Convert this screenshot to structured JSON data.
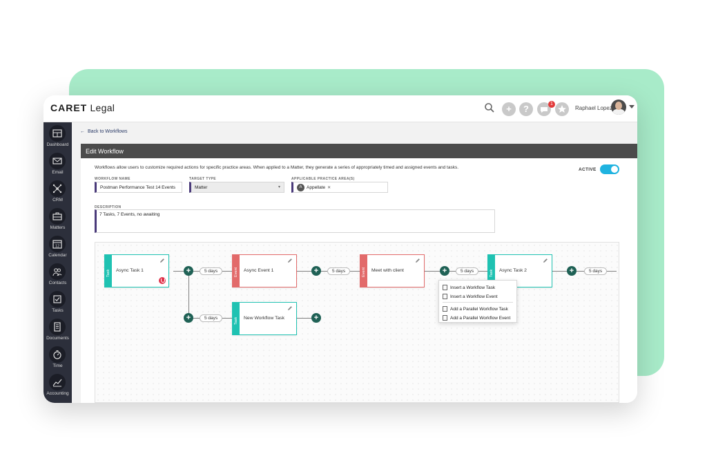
{
  "app": {
    "logo_prefix": "CARET",
    "logo_suffix": "Legal",
    "user_name": "Raphael Lopez",
    "notification_count": "1"
  },
  "toolbar": {
    "add_icon": "plus-icon",
    "help_label": "?",
    "icons": [
      "search-icon",
      "plus-icon",
      "help-icon",
      "chat-icon",
      "star-icon"
    ]
  },
  "sidebar": {
    "items": [
      {
        "label": "Dashboard",
        "icon": "dashboard-icon"
      },
      {
        "label": "Email",
        "icon": "envelope-icon"
      },
      {
        "label": "CRM",
        "icon": "network-icon"
      },
      {
        "label": "Matters",
        "icon": "briefcase-icon"
      },
      {
        "label": "Calendar",
        "icon": "calendar-icon"
      },
      {
        "label": "Contacts",
        "icon": "people-icon"
      },
      {
        "label": "Tasks",
        "icon": "checkbox-icon"
      },
      {
        "label": "Documents",
        "icon": "document-icon"
      },
      {
        "label": "Time",
        "icon": "timer-icon"
      },
      {
        "label": "Accounting",
        "icon": "chart-icon"
      }
    ]
  },
  "page": {
    "back_label": "Back to Workflows",
    "title": "Edit Workflow",
    "intro": "Workflows allow users to customize required actions for specific practice areas. When applied to a Matter, they generate a series of appropriately timed and assigned events and tasks.",
    "active_label": "ACTIVE",
    "active": true
  },
  "form": {
    "workflow_name_label": "WORKFLOW NAME",
    "workflow_name_value": "Postman Performance Test  14 Events",
    "target_type_label": "TARGET TYPE",
    "target_type_value": "Matter",
    "practice_area_label": "APPLICABLE PRACTICE AREA(S)",
    "practice_area_chip_initial": "A",
    "practice_area_chip": "Appellate",
    "description_label": "DESCRIPTION",
    "description_value": "7 Tasks, 7 Events, no awaiting"
  },
  "workflow": {
    "cards": [
      {
        "type": "Task",
        "title": "Async Task 1"
      },
      {
        "type": "Event",
        "title": "Async Event 1"
      },
      {
        "type": "Event",
        "title": "Meet with client"
      },
      {
        "type": "Task",
        "title": "Async Task 2"
      },
      {
        "type": "Task",
        "title": "New Workflow Task"
      }
    ],
    "delays": [
      "5 days",
      "5 days",
      "5 days",
      "5 days",
      "5 days"
    ],
    "context_menu": [
      "Insert a Workflow Task",
      "Insert a Workflow Event",
      "Add a Parallel Workflow Task",
      "Add a Parallel Workflow Event"
    ]
  },
  "colors": {
    "accent_green": "#a8ebc9",
    "task": "#1fc2b2",
    "event": "#e26a6a",
    "connector": "#1f6155",
    "toggle": "#1fb3e0"
  }
}
